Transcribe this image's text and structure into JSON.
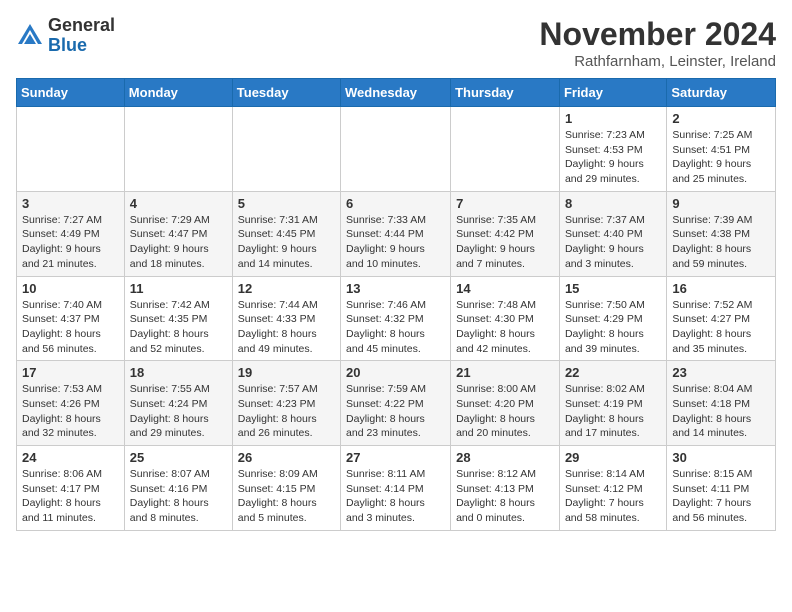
{
  "logo": {
    "general": "General",
    "blue": "Blue"
  },
  "header": {
    "month": "November 2024",
    "location": "Rathfarnham, Leinster, Ireland"
  },
  "columns": [
    "Sunday",
    "Monday",
    "Tuesday",
    "Wednesday",
    "Thursday",
    "Friday",
    "Saturday"
  ],
  "weeks": [
    [
      {
        "day": "",
        "info": ""
      },
      {
        "day": "",
        "info": ""
      },
      {
        "day": "",
        "info": ""
      },
      {
        "day": "",
        "info": ""
      },
      {
        "day": "",
        "info": ""
      },
      {
        "day": "1",
        "info": "Sunrise: 7:23 AM\nSunset: 4:53 PM\nDaylight: 9 hours and 29 minutes."
      },
      {
        "day": "2",
        "info": "Sunrise: 7:25 AM\nSunset: 4:51 PM\nDaylight: 9 hours and 25 minutes."
      }
    ],
    [
      {
        "day": "3",
        "info": "Sunrise: 7:27 AM\nSunset: 4:49 PM\nDaylight: 9 hours and 21 minutes."
      },
      {
        "day": "4",
        "info": "Sunrise: 7:29 AM\nSunset: 4:47 PM\nDaylight: 9 hours and 18 minutes."
      },
      {
        "day": "5",
        "info": "Sunrise: 7:31 AM\nSunset: 4:45 PM\nDaylight: 9 hours and 14 minutes."
      },
      {
        "day": "6",
        "info": "Sunrise: 7:33 AM\nSunset: 4:44 PM\nDaylight: 9 hours and 10 minutes."
      },
      {
        "day": "7",
        "info": "Sunrise: 7:35 AM\nSunset: 4:42 PM\nDaylight: 9 hours and 7 minutes."
      },
      {
        "day": "8",
        "info": "Sunrise: 7:37 AM\nSunset: 4:40 PM\nDaylight: 9 hours and 3 minutes."
      },
      {
        "day": "9",
        "info": "Sunrise: 7:39 AM\nSunset: 4:38 PM\nDaylight: 8 hours and 59 minutes."
      }
    ],
    [
      {
        "day": "10",
        "info": "Sunrise: 7:40 AM\nSunset: 4:37 PM\nDaylight: 8 hours and 56 minutes."
      },
      {
        "day": "11",
        "info": "Sunrise: 7:42 AM\nSunset: 4:35 PM\nDaylight: 8 hours and 52 minutes."
      },
      {
        "day": "12",
        "info": "Sunrise: 7:44 AM\nSunset: 4:33 PM\nDaylight: 8 hours and 49 minutes."
      },
      {
        "day": "13",
        "info": "Sunrise: 7:46 AM\nSunset: 4:32 PM\nDaylight: 8 hours and 45 minutes."
      },
      {
        "day": "14",
        "info": "Sunrise: 7:48 AM\nSunset: 4:30 PM\nDaylight: 8 hours and 42 minutes."
      },
      {
        "day": "15",
        "info": "Sunrise: 7:50 AM\nSunset: 4:29 PM\nDaylight: 8 hours and 39 minutes."
      },
      {
        "day": "16",
        "info": "Sunrise: 7:52 AM\nSunset: 4:27 PM\nDaylight: 8 hours and 35 minutes."
      }
    ],
    [
      {
        "day": "17",
        "info": "Sunrise: 7:53 AM\nSunset: 4:26 PM\nDaylight: 8 hours and 32 minutes."
      },
      {
        "day": "18",
        "info": "Sunrise: 7:55 AM\nSunset: 4:24 PM\nDaylight: 8 hours and 29 minutes."
      },
      {
        "day": "19",
        "info": "Sunrise: 7:57 AM\nSunset: 4:23 PM\nDaylight: 8 hours and 26 minutes."
      },
      {
        "day": "20",
        "info": "Sunrise: 7:59 AM\nSunset: 4:22 PM\nDaylight: 8 hours and 23 minutes."
      },
      {
        "day": "21",
        "info": "Sunrise: 8:00 AM\nSunset: 4:20 PM\nDaylight: 8 hours and 20 minutes."
      },
      {
        "day": "22",
        "info": "Sunrise: 8:02 AM\nSunset: 4:19 PM\nDaylight: 8 hours and 17 minutes."
      },
      {
        "day": "23",
        "info": "Sunrise: 8:04 AM\nSunset: 4:18 PM\nDaylight: 8 hours and 14 minutes."
      }
    ],
    [
      {
        "day": "24",
        "info": "Sunrise: 8:06 AM\nSunset: 4:17 PM\nDaylight: 8 hours and 11 minutes."
      },
      {
        "day": "25",
        "info": "Sunrise: 8:07 AM\nSunset: 4:16 PM\nDaylight: 8 hours and 8 minutes."
      },
      {
        "day": "26",
        "info": "Sunrise: 8:09 AM\nSunset: 4:15 PM\nDaylight: 8 hours and 5 minutes."
      },
      {
        "day": "27",
        "info": "Sunrise: 8:11 AM\nSunset: 4:14 PM\nDaylight: 8 hours and 3 minutes."
      },
      {
        "day": "28",
        "info": "Sunrise: 8:12 AM\nSunset: 4:13 PM\nDaylight: 8 hours and 0 minutes."
      },
      {
        "day": "29",
        "info": "Sunrise: 8:14 AM\nSunset: 4:12 PM\nDaylight: 7 hours and 58 minutes."
      },
      {
        "day": "30",
        "info": "Sunrise: 8:15 AM\nSunset: 4:11 PM\nDaylight: 7 hours and 56 minutes."
      }
    ]
  ]
}
